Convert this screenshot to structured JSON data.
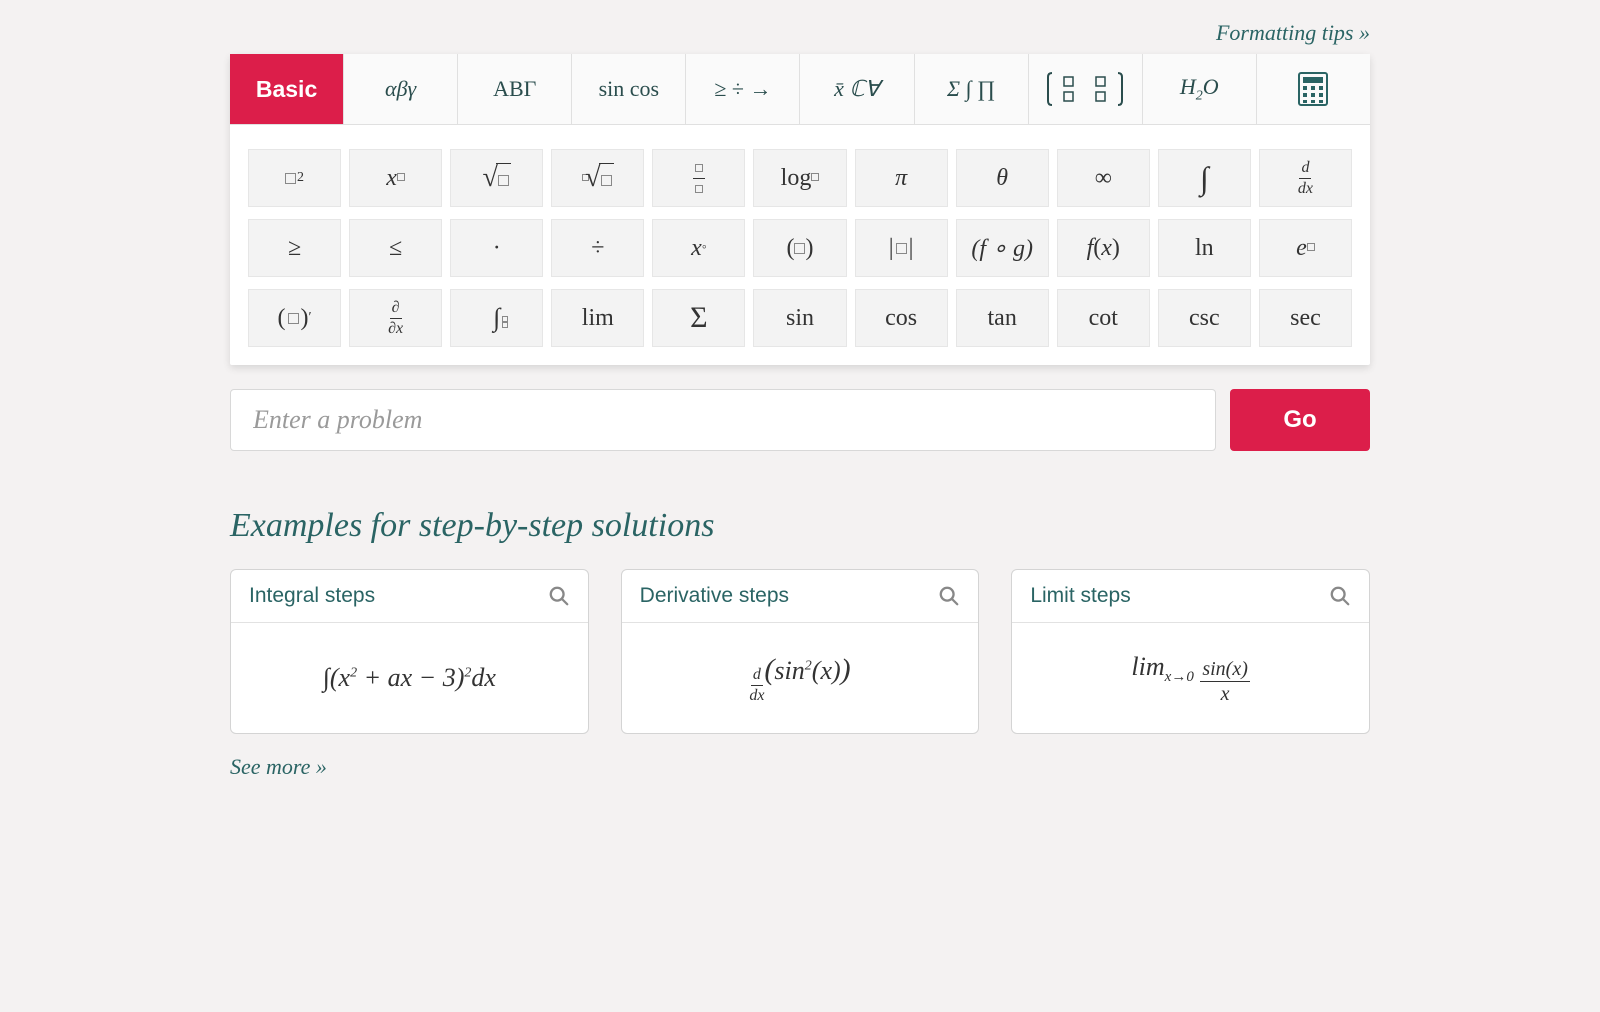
{
  "tips_link": "Formatting tips »",
  "tabs": {
    "basic": "Basic",
    "greek_lower": "αβγ",
    "greek_upper": "ΑΒΓ",
    "trig": "sin cos",
    "ops": "≥ ÷ →",
    "sets": "x̄ ℂ∀",
    "sums": "Σ ∫ ∏",
    "matrix": "matrix",
    "chem": "H₂O",
    "calc": "calculator"
  },
  "symbols": {
    "r1": [
      "□²",
      "x□",
      "√□",
      "ⁿ√□",
      "□/□",
      "log□",
      "π",
      "θ",
      "∞",
      "∫",
      "d/dx"
    ],
    "r2": [
      "≥",
      "≤",
      "·",
      "÷",
      "x°",
      "( □ )",
      "|□|",
      "(f ∘ g)",
      "f(x)",
      "ln",
      "e□"
    ],
    "r3": [
      "(□)'",
      "∂/∂x",
      "∫□□",
      "lim",
      "Σ",
      "sin",
      "cos",
      "tan",
      "cot",
      "csc",
      "sec"
    ]
  },
  "input": {
    "placeholder": "Enter a problem",
    "go": "Go"
  },
  "examples_heading": "Examples for step-by-step solutions",
  "examples": [
    {
      "title": "Integral steps",
      "expr": "∫(x² + ax − 3)² dx"
    },
    {
      "title": "Derivative steps",
      "expr": "d/dx (sin²(x))"
    },
    {
      "title": "Limit steps",
      "expr": "limₓ→0 sin(x)/x"
    }
  ],
  "see_more": "See more »"
}
